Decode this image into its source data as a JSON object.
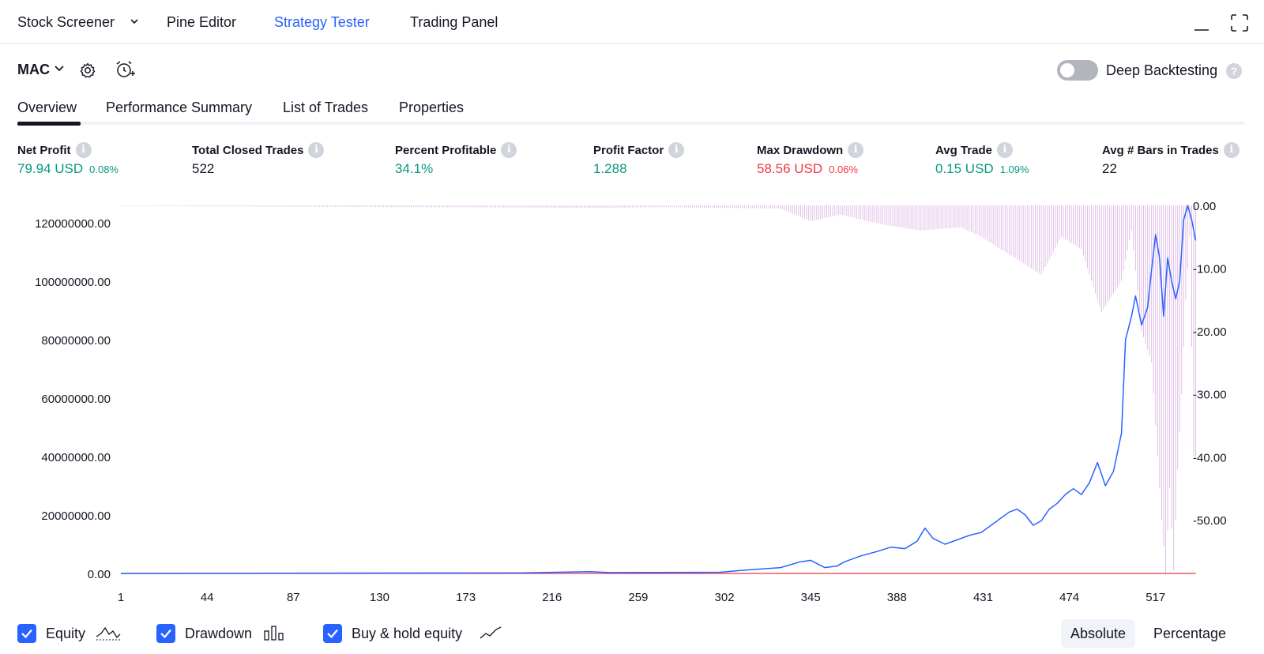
{
  "topnav": {
    "tabs": [
      {
        "label": "Stock Screener",
        "active": false
      },
      {
        "label": "Pine Editor",
        "active": false
      },
      {
        "label": "Strategy Tester",
        "active": true
      },
      {
        "label": "Trading Panel",
        "active": false
      }
    ]
  },
  "toolbar": {
    "symbol": "MAC",
    "deep_backtesting_label": "Deep Backtesting",
    "deep_backtesting_enabled": false,
    "help": "?"
  },
  "subtabs": [
    {
      "label": "Overview",
      "active": true
    },
    {
      "label": "Performance Summary",
      "active": false
    },
    {
      "label": "List of Trades",
      "active": false
    },
    {
      "label": "Properties",
      "active": false
    }
  ],
  "metrics": [
    {
      "label": "Net Profit",
      "value": "79.94 USD",
      "pct": "0.08%",
      "tone": "green"
    },
    {
      "label": "Total Closed Trades",
      "value": "522",
      "pct": "",
      "tone": "black"
    },
    {
      "label": "Percent Profitable",
      "value": "34.1%",
      "pct": "",
      "tone": "green"
    },
    {
      "label": "Profit Factor",
      "value": "1.288",
      "pct": "",
      "tone": "green"
    },
    {
      "label": "Max Drawdown",
      "value": "58.56 USD",
      "pct": "0.06%",
      "tone": "red"
    },
    {
      "label": "Avg Trade",
      "value": "0.15 USD",
      "pct": "1.09%",
      "tone": "green"
    },
    {
      "label": "Avg # Bars in Trades",
      "value": "22",
      "pct": "",
      "tone": "black"
    }
  ],
  "info_glyph": "i",
  "legend": {
    "items": [
      {
        "label": "Equity",
        "checked": true
      },
      {
        "label": "Drawdown",
        "checked": true
      },
      {
        "label": "Buy & hold equity",
        "checked": true
      }
    ],
    "modes": [
      {
        "label": "Absolute",
        "active": true
      },
      {
        "label": "Percentage",
        "active": false
      }
    ]
  },
  "colors": {
    "accent": "#2962ff",
    "equity": "#2962ff",
    "drawdown": "#e1bee7",
    "buy_hold": "#f23645",
    "green": "#089981",
    "red": "#f23645"
  },
  "chart_data": {
    "type": "line",
    "title": "",
    "xlabel": "",
    "ylabel": "",
    "x_ticks": [
      1,
      44,
      87,
      130,
      173,
      216,
      259,
      302,
      345,
      388,
      431,
      474,
      517
    ],
    "x_range": [
      1,
      523
    ],
    "left_axis": {
      "ticks": [
        "0.00",
        "20000000.00",
        "40000000.00",
        "60000000.00",
        "80000000.00",
        "100000000.00",
        "120000000.00"
      ],
      "range": [
        0,
        126000000
      ]
    },
    "right_axis": {
      "ticks": [
        "0.00",
        "-10.00",
        "-20.00",
        "-30.00",
        "-40.00",
        "-50.00"
      ],
      "range": [
        -58.56,
        0
      ]
    },
    "series": [
      {
        "name": "Equity",
        "axis": "left",
        "points": [
          [
            1,
            0
          ],
          [
            100,
            100000
          ],
          [
            200,
            150000
          ],
          [
            235,
            600000
          ],
          [
            245,
            300000
          ],
          [
            300,
            400000
          ],
          [
            310,
            1000000
          ],
          [
            330,
            2000000
          ],
          [
            340,
            4000000
          ],
          [
            345,
            4500000
          ],
          [
            352,
            2000000
          ],
          [
            358,
            2500000
          ],
          [
            362,
            4000000
          ],
          [
            370,
            6000000
          ],
          [
            378,
            7500000
          ],
          [
            385,
            9000000
          ],
          [
            392,
            8500000
          ],
          [
            398,
            11000000
          ],
          [
            402,
            15500000
          ],
          [
            406,
            12000000
          ],
          [
            412,
            10000000
          ],
          [
            418,
            11500000
          ],
          [
            424,
            13000000
          ],
          [
            430,
            14000000
          ],
          [
            436,
            17000000
          ],
          [
            440,
            19000000
          ],
          [
            444,
            21000000
          ],
          [
            448,
            22000000
          ],
          [
            452,
            20000000
          ],
          [
            456,
            16500000
          ],
          [
            460,
            18000000
          ],
          [
            464,
            22000000
          ],
          [
            468,
            24000000
          ],
          [
            472,
            27000000
          ],
          [
            476,
            29000000
          ],
          [
            480,
            27000000
          ],
          [
            484,
            31000000
          ],
          [
            488,
            38000000
          ],
          [
            492,
            30000000
          ],
          [
            496,
            35000000
          ],
          [
            500,
            48000000
          ],
          [
            502,
            80000000
          ],
          [
            505,
            88000000
          ],
          [
            507,
            95000000
          ],
          [
            510,
            85000000
          ],
          [
            513,
            91000000
          ],
          [
            515,
            104000000
          ],
          [
            517,
            116000000
          ],
          [
            519,
            108000000
          ],
          [
            521,
            88000000
          ],
          [
            523,
            108000000
          ],
          [
            525,
            100000000
          ],
          [
            527,
            94000000
          ],
          [
            529,
            100000000
          ],
          [
            531,
            121000000
          ],
          [
            533,
            126000000
          ],
          [
            535,
            121000000
          ],
          [
            537,
            114000000
          ]
        ]
      },
      {
        "name": "Drawdown",
        "axis": "right",
        "points": [
          [
            1,
            -0.1
          ],
          [
            240,
            -0.4
          ],
          [
            270,
            -0.3
          ],
          [
            330,
            -0.5
          ],
          [
            345,
            -2.5
          ],
          [
            360,
            -1.5
          ],
          [
            380,
            -3.0
          ],
          [
            400,
            -4.0
          ],
          [
            420,
            -3.5
          ],
          [
            430,
            -5.0
          ],
          [
            445,
            -8.0
          ],
          [
            460,
            -11.0
          ],
          [
            470,
            -5.0
          ],
          [
            480,
            -7.0
          ],
          [
            490,
            -17.0
          ],
          [
            500,
            -12.0
          ],
          [
            505,
            -4.0
          ],
          [
            510,
            -20.0
          ],
          [
            515,
            -25.0
          ],
          [
            518,
            -40.0
          ],
          [
            520,
            -50.0
          ],
          [
            522,
            -58.5
          ],
          [
            524,
            -45.0
          ],
          [
            526,
            -58.0
          ],
          [
            528,
            -42.0
          ],
          [
            530,
            -30.0
          ],
          [
            532,
            -15.0
          ],
          [
            534,
            -5.0
          ],
          [
            536,
            -40.0
          ]
        ]
      },
      {
        "name": "Buy & hold equity",
        "axis": "left",
        "points": [
          [
            1,
            0
          ],
          [
            537,
            0
          ]
        ]
      }
    ]
  }
}
